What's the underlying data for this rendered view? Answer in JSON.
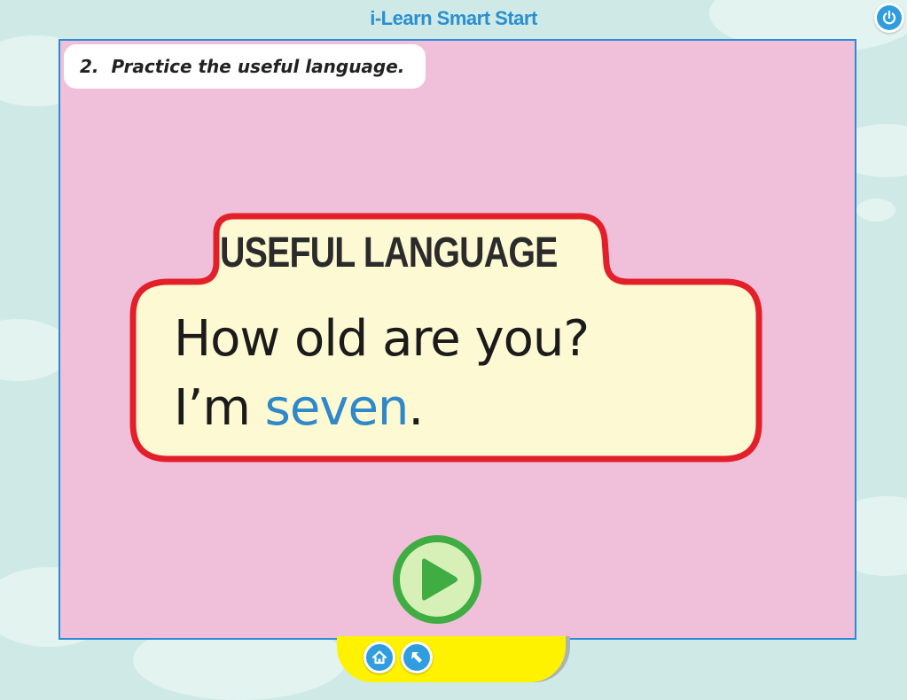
{
  "app": {
    "title": "i-Learn Smart Start"
  },
  "activity": {
    "instruction": "2.  Practice the useful language."
  },
  "useful_language": {
    "heading": "USEFUL LANGUAGE",
    "question": "How old are you?",
    "answer_prefix": "I’m ",
    "answer_highlight": "seven",
    "answer_suffix": "."
  },
  "icons": {
    "power": "power-icon",
    "play": "play-icon",
    "home": "home-icon",
    "back": "back-arrow-icon"
  },
  "colors": {
    "background": "#cfeae6",
    "stage_background": "#f0bfd9",
    "stage_border": "#2d8ad6",
    "title": "#2a8fd0",
    "box_fill": "#fdf9d2",
    "box_border": "#e3202a",
    "highlight": "#2f88c9",
    "play_green": "#3fad42",
    "nav_bar": "#fff200",
    "nav_button": "#2f9ddf"
  }
}
